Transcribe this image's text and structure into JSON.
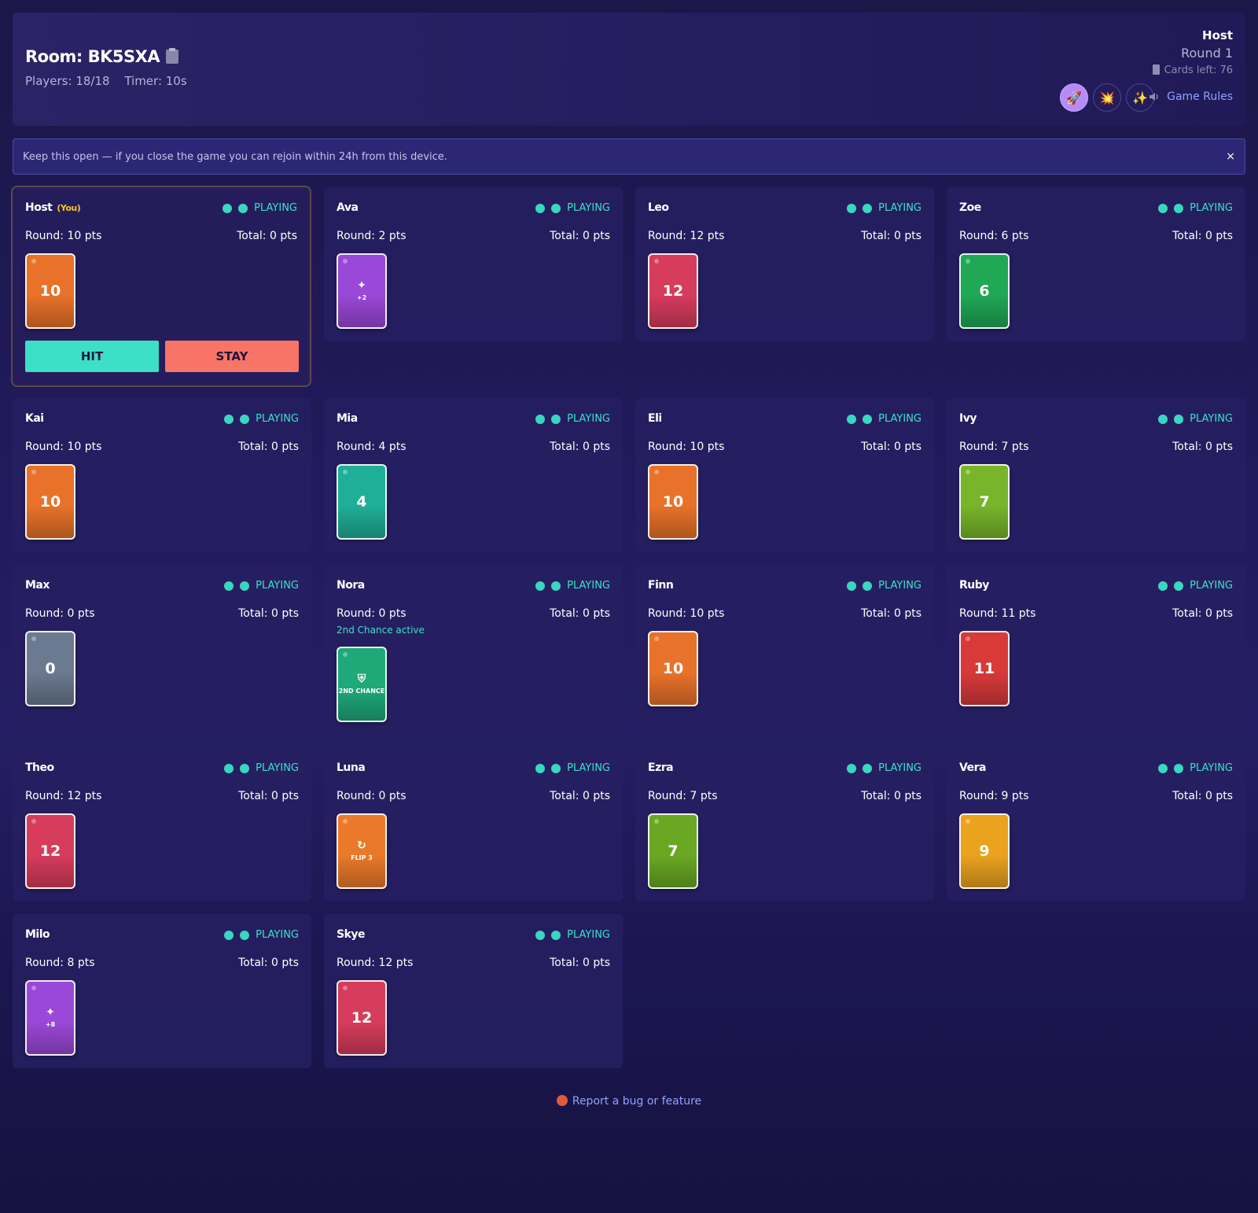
{
  "header": {
    "room_title": "Room: BK5SXA",
    "players": "Players: 18/18",
    "timer": "Timer: 10s",
    "host": "Host",
    "round": "Round 1",
    "cards_left": "Cards left: 76",
    "theme_buttons": [
      {
        "icon": "rocket-icon",
        "glyph": "🚀"
      },
      {
        "icon": "explosion-icon",
        "glyph": "💥"
      },
      {
        "icon": "sparkles-icon",
        "glyph": "✨"
      }
    ],
    "rules_label": "Game Rules"
  },
  "banner": {
    "text": "Keep this open — if you close the game you can rejoin within 24h from this device.",
    "close": "×"
  },
  "you_tag": "(You)",
  "status_label": "PLAYING",
  "actions": {
    "hit": "HIT",
    "stay": "STAY"
  },
  "players": [
    {
      "name": "Host",
      "round": "Round: 10 pts",
      "total": "Total: 0 pts",
      "card": {
        "label": "10",
        "color": "#e8722a"
      }
    },
    {
      "name": "Ava",
      "round": "Round: 2 pts",
      "total": "Total: 0 pts",
      "card": {
        "symbol": "✦",
        "label": "+2",
        "color": "#9a48d8"
      }
    },
    {
      "name": "Leo",
      "round": "Round: 12 pts",
      "total": "Total: 0 pts",
      "card": {
        "label": "12",
        "color": "#d63c5c"
      }
    },
    {
      "name": "Zoe",
      "round": "Round: 6 pts",
      "total": "Total: 0 pts",
      "card": {
        "label": "6",
        "color": "#20a855"
      }
    },
    {
      "name": "Kai",
      "round": "Round: 10 pts",
      "total": "Total: 0 pts",
      "card": {
        "label": "10",
        "color": "#e8722a"
      }
    },
    {
      "name": "Mia",
      "round": "Round: 4 pts",
      "total": "Total: 0 pts",
      "card": {
        "label": "4",
        "color": "#1fae98"
      }
    },
    {
      "name": "Eli",
      "round": "Round: 10 pts",
      "total": "Total: 0 pts",
      "card": {
        "label": "10",
        "color": "#e8722a"
      }
    },
    {
      "name": "Ivy",
      "round": "Round: 7 pts",
      "total": "Total: 0 pts",
      "card": {
        "label": "7",
        "color": "#78b52a"
      }
    },
    {
      "name": "Max",
      "round": "Round: 0 pts",
      "total": "Total: 0 pts",
      "card": {
        "label": "0",
        "color": "#6b7a90"
      }
    },
    {
      "name": "Nora",
      "round": "Round: 0 pts",
      "total": "Total: 0 pts",
      "note": "2nd Chance active",
      "card": {
        "symbol": "⛨",
        "label": "2ND CHANCE",
        "color": "#1fa878"
      }
    },
    {
      "name": "Finn",
      "round": "Round: 10 pts",
      "total": "Total: 0 pts",
      "card": {
        "label": "10",
        "color": "#e8722a"
      }
    },
    {
      "name": "Ruby",
      "round": "Round: 11 pts",
      "total": "Total: 0 pts",
      "card": {
        "label": "11",
        "color": "#d83a3a"
      }
    },
    {
      "name": "Theo",
      "round": "Round: 12 pts",
      "total": "Total: 0 pts",
      "card": {
        "label": "12",
        "color": "#d63c5c"
      }
    },
    {
      "name": "Luna",
      "round": "Round: 0 pts",
      "total": "Total: 0 pts",
      "card": {
        "symbol": "↻",
        "label": "FLIP 3",
        "color": "#ea7a2a"
      }
    },
    {
      "name": "Ezra",
      "round": "Round: 7 pts",
      "total": "Total: 0 pts",
      "card": {
        "label": "7",
        "color": "#6aa824"
      }
    },
    {
      "name": "Vera",
      "round": "Round: 9 pts",
      "total": "Total: 0 pts",
      "card": {
        "label": "9",
        "color": "#eba21e"
      }
    },
    {
      "name": "Milo",
      "round": "Round: 8 pts",
      "total": "Total: 0 pts",
      "card": {
        "symbol": "✦",
        "label": "+8",
        "color": "#9a48d8"
      }
    },
    {
      "name": "Skye",
      "round": "Round: 12 pts",
      "total": "Total: 0 pts",
      "card": {
        "label": "12",
        "color": "#d63c5c"
      }
    }
  ],
  "footer": {
    "link": "Report a bug or feature"
  }
}
